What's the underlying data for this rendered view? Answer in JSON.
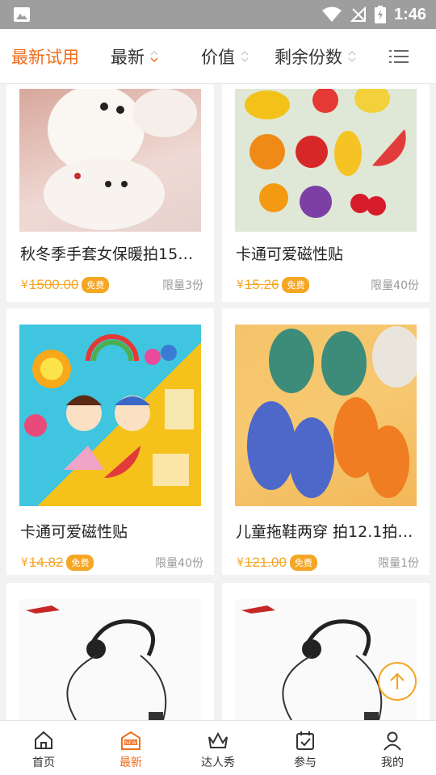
{
  "status_bar": {
    "time": "1:46"
  },
  "filter_bar": {
    "title": "最新试用",
    "filters": [
      {
        "label": "最新"
      },
      {
        "label": "价值"
      },
      {
        "label": "剩余份数"
      }
    ]
  },
  "products": [
    {
      "title": "秋冬季手套女保暖拍150...",
      "currency": "¥",
      "price": "1500.00",
      "badge": "免费",
      "limit": "限量3份"
    },
    {
      "title": "卡通可爱磁性贴",
      "currency": "¥",
      "price": "15.26",
      "badge": "免费",
      "limit": "限量40份"
    },
    {
      "title": "卡通可爱磁性贴",
      "currency": "¥",
      "price": "14.82",
      "badge": "免费",
      "limit": "限量40份"
    },
    {
      "title": "儿童拖鞋两穿 拍12.1拍1...",
      "currency": "¥",
      "price": "121.00",
      "badge": "免费",
      "limit": "限量1份"
    }
  ],
  "tab_bar": {
    "tabs": [
      {
        "label": "首页"
      },
      {
        "label": "最新"
      },
      {
        "label": "达人秀"
      },
      {
        "label": "参与"
      },
      {
        "label": "我的"
      }
    ],
    "active_index": 1
  },
  "colors": {
    "accent": "#f06d1c",
    "price": "#f5a623",
    "status_bar": "#9e9e9e"
  }
}
